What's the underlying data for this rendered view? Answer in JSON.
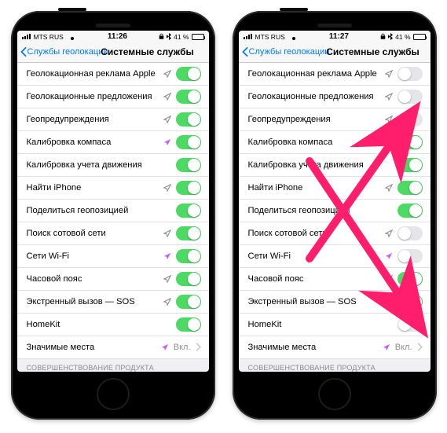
{
  "phones": [
    {
      "status": {
        "carrier": "MTS RUS",
        "time": "11:26",
        "battery_pct": "41 %",
        "battery_fill": 41
      },
      "nav": {
        "back": "Службы геолокации",
        "title": "Системные службы"
      },
      "items": [
        {
          "label": "Геолокационная реклама Apple",
          "on": true,
          "arrow": "hollow"
        },
        {
          "label": "Геолокационные предложения",
          "on": true,
          "arrow": "hollow"
        },
        {
          "label": "Геопредупреждения",
          "on": true,
          "arrow": "hollow"
        },
        {
          "label": "Калибровка компаса",
          "on": true,
          "arrow": "filled"
        },
        {
          "label": "Калибровка учета движения",
          "on": true,
          "arrow": ""
        },
        {
          "label": "Найти iPhone",
          "on": true,
          "arrow": "hollow"
        },
        {
          "label": "Поделиться геопозицией",
          "on": true,
          "arrow": ""
        },
        {
          "label": "Поиск сотовой сети",
          "on": true,
          "arrow": "hollow"
        },
        {
          "label": "Сети Wi-Fi",
          "on": true,
          "arrow": "filled"
        },
        {
          "label": "Часовой пояс",
          "on": true,
          "arrow": "hollow"
        },
        {
          "label": "Экстренный вызов — SOS",
          "on": true,
          "arrow": "hollow"
        },
        {
          "label": "HomeKit",
          "on": true,
          "arrow": ""
        }
      ],
      "link": {
        "label": "Значимые места",
        "value": "Вкл.",
        "arrow": "filled"
      },
      "footer": "СОВЕРШЕНСТВОВАНИЕ ПРОДУКТА"
    },
    {
      "status": {
        "carrier": "MTS RUS",
        "time": "11:27",
        "battery_pct": "41 %",
        "battery_fill": 41
      },
      "nav": {
        "back": "Службы геолокации",
        "title": "Системные службы"
      },
      "items": [
        {
          "label": "Геолокационная реклама Apple",
          "on": false,
          "arrow": "hollow"
        },
        {
          "label": "Геолокационные предложения",
          "on": false,
          "arrow": "hollow"
        },
        {
          "label": "Геопредупреждения",
          "on": false,
          "arrow": "hollow"
        },
        {
          "label": "Калибровка компаса",
          "on": true,
          "arrow": "filled"
        },
        {
          "label": "Калибровка учета движения",
          "on": true,
          "arrow": ""
        },
        {
          "label": "Найти iPhone",
          "on": true,
          "arrow": "hollow"
        },
        {
          "label": "Поделиться геопозицией",
          "on": true,
          "arrow": ""
        },
        {
          "label": "Поиск сотовой сети",
          "on": false,
          "arrow": "hollow"
        },
        {
          "label": "Сети Wi-Fi",
          "on": false,
          "arrow": "filled"
        },
        {
          "label": "Часовой пояс",
          "on": true,
          "arrow": "hollow"
        },
        {
          "label": "Экстренный вызов — SOS",
          "on": true,
          "arrow": "hollow"
        },
        {
          "label": "HomeKit",
          "on": false,
          "arrow": ""
        }
      ],
      "link": {
        "label": "Значимые места",
        "value": "Вкл.",
        "arrow": "filled"
      },
      "footer": "СОВЕРШЕНСТВОВАНИЕ ПРОДУКТА"
    }
  ],
  "annotation_color": "#ff1e6b"
}
